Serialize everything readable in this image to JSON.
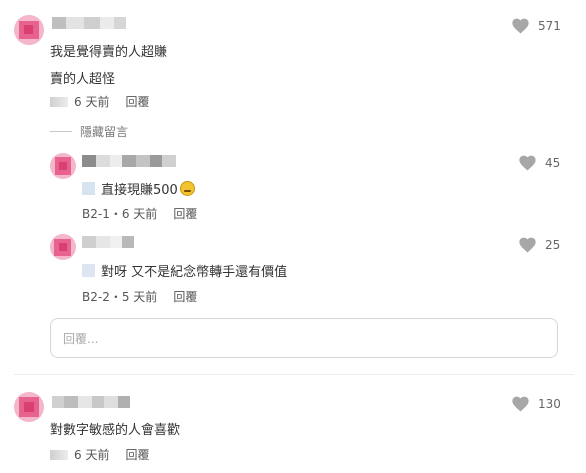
{
  "comments": [
    {
      "lines": [
        "我是覺得賣的人超賺",
        "賣的人超怪"
      ],
      "meta_time": "6 天前",
      "reply_label": "回覆",
      "likes": "571"
    },
    {
      "lines": [
        "對數字敏感的人會喜歡"
      ],
      "meta_time": "6 天前",
      "reply_label": "回覆",
      "likes": "130"
    }
  ],
  "hide_replies_label": "隱藏留言",
  "replies": [
    {
      "text": "直接現賺500",
      "floor": "B2-1",
      "time": "6 天前",
      "reply_label": "回覆",
      "likes": "45"
    },
    {
      "text": "對呀 又不是紀念幣轉手還有價值",
      "floor": "B2-2",
      "time": "5 天前",
      "reply_label": "回覆",
      "likes": "25"
    }
  ],
  "reply_input": {
    "placeholder": "回覆..."
  },
  "colors": {
    "heart": "#a7a7a7",
    "avatar_pink": "#e8628f",
    "avatar_light": "#f4b6c9"
  },
  "icons": {
    "like": "heart-icon",
    "emoji": "grinning-face-emoji"
  }
}
